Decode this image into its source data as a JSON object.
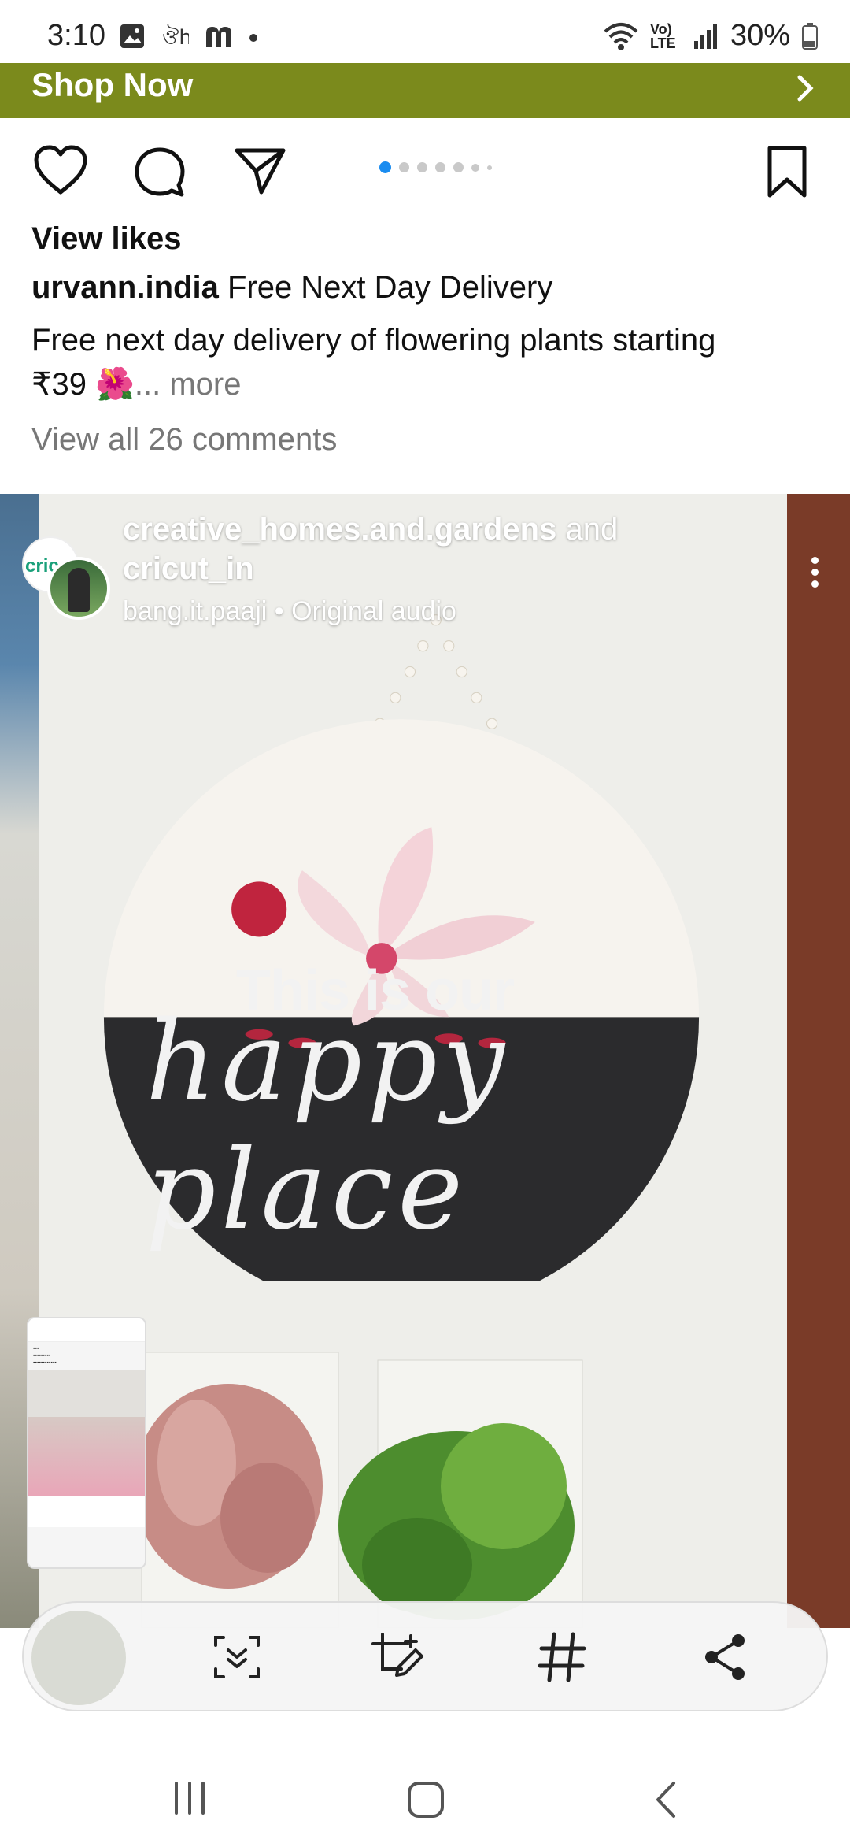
{
  "status_bar": {
    "time": "3:10",
    "network": "Vo) LTE",
    "battery": "30%"
  },
  "ad_banner": {
    "label": "Shop Now"
  },
  "post1": {
    "view_likes": "View likes",
    "username": "urvann.india",
    "headline": "Free Next Day Delivery",
    "description_line1": "Free next day delivery of flowering plants starting",
    "description_line2": "₹39 🌺",
    "more_label": "... more",
    "comments_label": "View all 26 comments",
    "carousel_dots": 7
  },
  "post2": {
    "user1": "creative_homes.and.gardens",
    "joiner": "and",
    "user2": "cricut_in",
    "avatar_text": "cric",
    "audio": "bang.it.paaji • Original audio",
    "sign_line1": "This is our",
    "sign_line2": "happy place"
  },
  "toolbar": {
    "icons": [
      "scroll-capture-icon",
      "crop-edit-icon",
      "hashtag-icon",
      "share-icon"
    ]
  },
  "navbar": {
    "icons": [
      "recents-icon",
      "home-icon",
      "back-icon"
    ]
  }
}
